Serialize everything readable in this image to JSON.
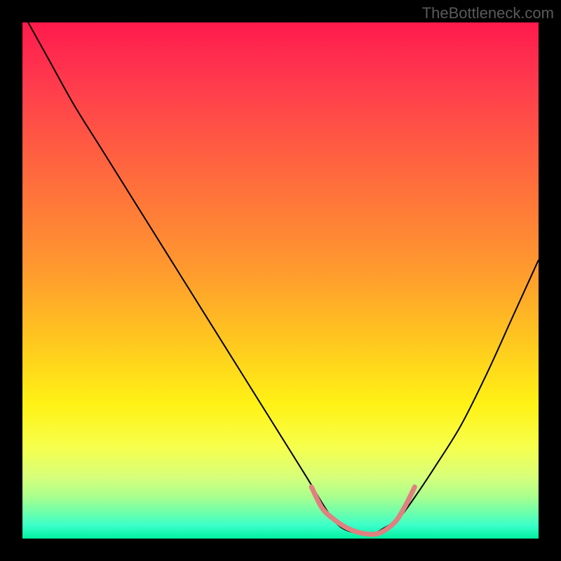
{
  "watermark": "TheBottleneck.com",
  "chart_data": {
    "type": "line",
    "title": "",
    "xlabel": "",
    "ylabel": "",
    "xlim": [
      0,
      100
    ],
    "ylim": [
      0,
      100
    ],
    "grid": false,
    "curve": {
      "name": "bottleneck-curve",
      "color": "#000000",
      "x": [
        0,
        5,
        10,
        15,
        20,
        25,
        30,
        35,
        40,
        45,
        50,
        55,
        58,
        60,
        62,
        65,
        68,
        70,
        73,
        76,
        80,
        85,
        90,
        95,
        100
      ],
      "y": [
        102,
        93,
        84,
        76,
        68,
        60,
        52,
        44,
        36,
        28,
        20,
        12,
        7,
        4,
        2,
        1,
        1,
        2,
        4,
        8,
        14,
        22,
        32,
        43,
        54
      ]
    },
    "highlight": {
      "name": "optimal-range",
      "color": "#e08080",
      "stroke_width": 7,
      "x": [
        56,
        58,
        60,
        63,
        66,
        69,
        72,
        74,
        76
      ],
      "y": [
        10,
        6,
        4,
        2,
        1,
        1,
        3,
        6,
        10
      ]
    },
    "gradient_stops": [
      {
        "offset": 0.0,
        "color": "#ff1a4d"
      },
      {
        "offset": 0.12,
        "color": "#ff3b4d"
      },
      {
        "offset": 0.3,
        "color": "#ff6b3d"
      },
      {
        "offset": 0.48,
        "color": "#ff9a2e"
      },
      {
        "offset": 0.62,
        "color": "#ffc81f"
      },
      {
        "offset": 0.74,
        "color": "#fff215"
      },
      {
        "offset": 0.82,
        "color": "#f7ff4a"
      },
      {
        "offset": 0.88,
        "color": "#d8ff7a"
      },
      {
        "offset": 0.92,
        "color": "#a8ff8e"
      },
      {
        "offset": 0.95,
        "color": "#6cffac"
      },
      {
        "offset": 0.975,
        "color": "#3affc9"
      },
      {
        "offset": 1.0,
        "color": "#00f0a0"
      }
    ]
  }
}
